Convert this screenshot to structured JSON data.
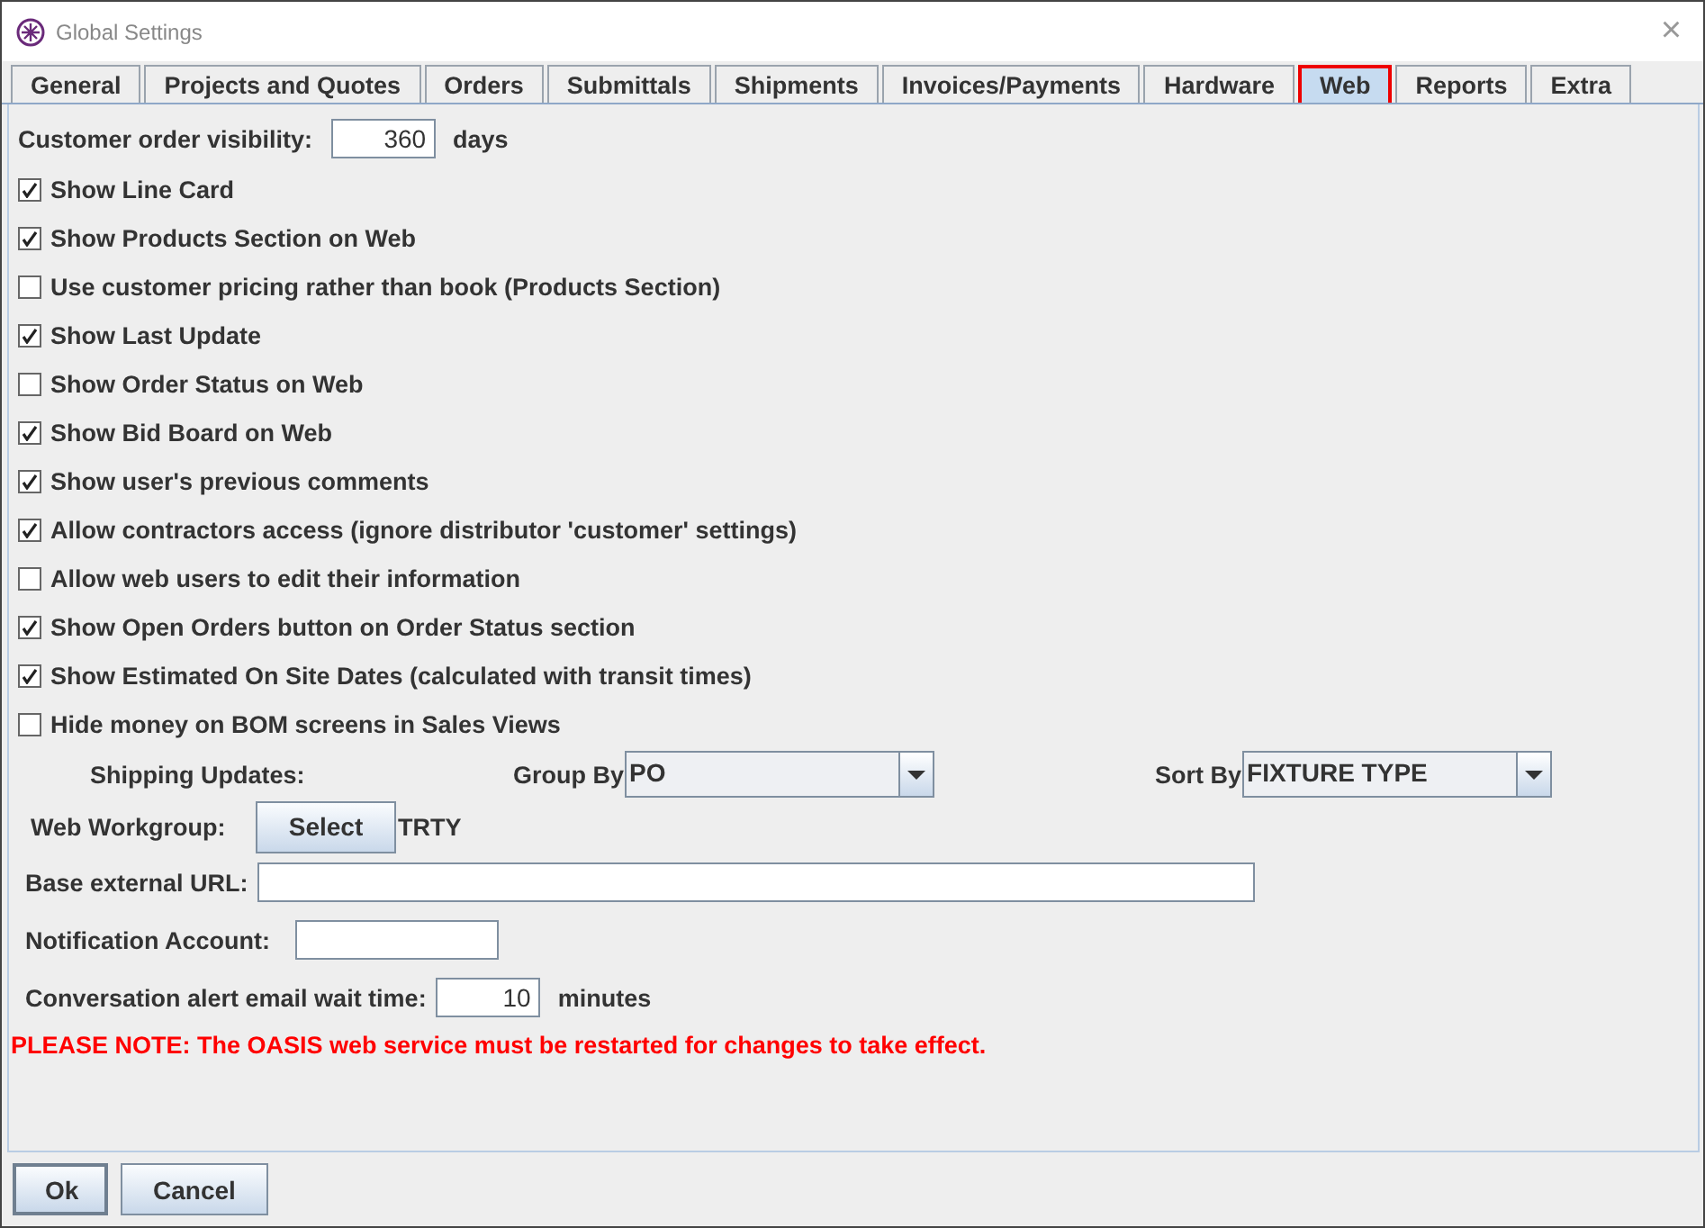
{
  "window": {
    "title": "Global Settings",
    "close": "×"
  },
  "tabs": [
    {
      "label": "General",
      "selected": false,
      "highlighted": false
    },
    {
      "label": "Projects and Quotes",
      "selected": false,
      "highlighted": false
    },
    {
      "label": "Orders",
      "selected": false,
      "highlighted": false
    },
    {
      "label": "Submittals",
      "selected": false,
      "highlighted": false
    },
    {
      "label": "Shipments",
      "selected": false,
      "highlighted": false
    },
    {
      "label": "Invoices/Payments",
      "selected": false,
      "highlighted": false
    },
    {
      "label": "Hardware",
      "selected": false,
      "highlighted": false
    },
    {
      "label": "Web",
      "selected": true,
      "highlighted": true
    },
    {
      "label": "Reports",
      "selected": false,
      "highlighted": false
    },
    {
      "label": "Extra",
      "selected": false,
      "highlighted": false
    }
  ],
  "visibility": {
    "label": "Customer order visibility:",
    "value": "360",
    "unit": "days"
  },
  "options": [
    {
      "label": "Show Line Card",
      "checked": true
    },
    {
      "label": "Show Products Section on Web",
      "checked": true
    },
    {
      "label": "Use customer pricing rather than book (Products Section)",
      "checked": false
    },
    {
      "label": "Show Last Update",
      "checked": true
    },
    {
      "label": "Show Order Status on Web",
      "checked": false
    },
    {
      "label": "Show Bid Board on Web",
      "checked": true
    },
    {
      "label": "Show user's previous comments",
      "checked": true
    },
    {
      "label": "Allow contractors access (ignore distributor 'customer' settings)",
      "checked": true
    },
    {
      "label": "Allow web users to edit their information",
      "checked": false
    },
    {
      "label": "Show Open Orders button on Order Status section",
      "checked": true
    },
    {
      "label": "Show Estimated On Site Dates (calculated with transit times)",
      "checked": true
    },
    {
      "label": "Hide money on BOM screens in Sales Views",
      "checked": false
    }
  ],
  "shipping": {
    "label": "Shipping Updates:",
    "group_by": {
      "label": "Group By",
      "value": "PO"
    },
    "sort_by": {
      "label": "Sort By",
      "value": "FIXTURE TYPE"
    }
  },
  "workgroup": {
    "label": "Web Workgroup:",
    "button": "Select",
    "value": "TRTY"
  },
  "base_url": {
    "label": "Base external URL:"
  },
  "notification": {
    "label": "Notification Account:"
  },
  "alert_wait": {
    "label": "Conversation alert email wait time:",
    "value": "10",
    "unit": "minutes"
  },
  "note": "PLEASE NOTE: The OASIS web service must be restarted for changes to take effect.",
  "buttons": [
    "Ok",
    "Cancel"
  ]
}
